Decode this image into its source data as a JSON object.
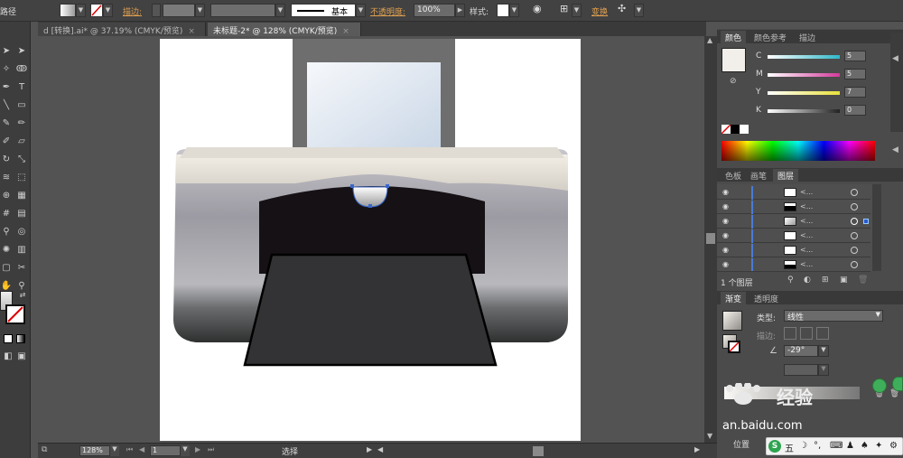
{
  "topbar": {
    "path_label": "路径",
    "stroke_label": "描边:",
    "basic_label": "基本",
    "opacity_label": "不透明度:",
    "opacity_value": "100%",
    "style_label": "样式:",
    "transform_label": "变换"
  },
  "tabs": [
    {
      "label": "d [转换].ai* @ 37.19% (CMYK/预览)",
      "active": false,
      "close": "×"
    },
    {
      "label": "未标题-2* @ 128% (CMYK/预览)",
      "active": true,
      "close": "×"
    }
  ],
  "status": {
    "zoom": "128%",
    "artboard": "1",
    "tool_state": "选择"
  },
  "color_panel": {
    "tabs": [
      "颜色",
      "颜色参考",
      "描边"
    ],
    "channels": [
      {
        "label": "C",
        "value": "5"
      },
      {
        "label": "M",
        "value": "5"
      },
      {
        "label": "Y",
        "value": "7"
      },
      {
        "label": "K",
        "value": "0"
      }
    ],
    "colors": {
      "c": "#2fb7c9",
      "m": "#d33a9a",
      "y": "#e8e13a",
      "k": "#222222",
      "fill": "#f2efea"
    }
  },
  "layers_panel": {
    "tabs": [
      "色板",
      "画笔",
      "图层"
    ],
    "rows": [
      {
        "name": "<..."
      },
      {
        "name": "<..."
      },
      {
        "name": "<..."
      },
      {
        "name": "<..."
      },
      {
        "name": "<..."
      },
      {
        "name": "<..."
      }
    ],
    "footer": "1 个图层"
  },
  "gradient_panel": {
    "tabs": [
      "渐变",
      "透明度"
    ],
    "type_label": "类型:",
    "type_value": "线性",
    "stroke_label": "描边:",
    "angle_value": "-29°"
  },
  "watermark": {
    "brand": "经验",
    "url": "an.baidu.com"
  },
  "ime": {
    "label": "五"
  },
  "partial_label": "位置"
}
